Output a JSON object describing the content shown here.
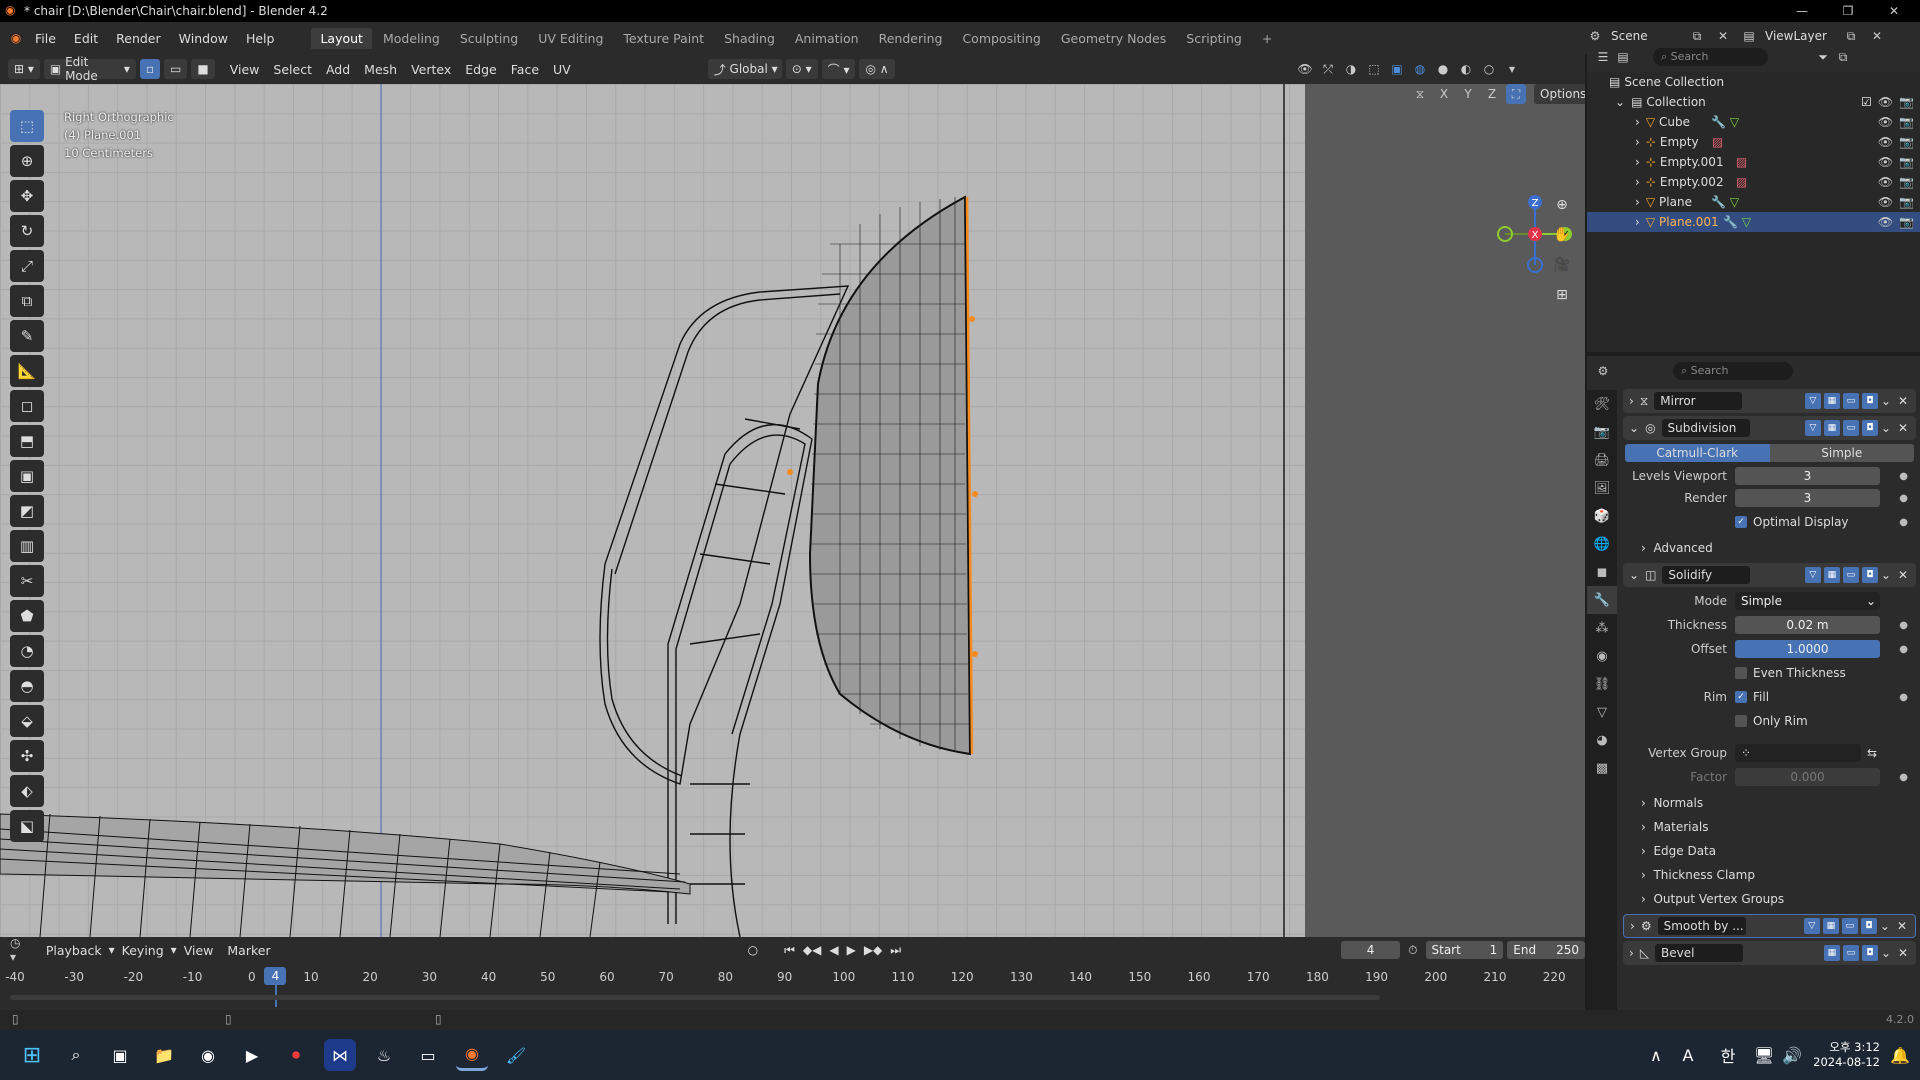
{
  "window": {
    "title": "* chair [D:\\Blender\\Chair\\chair.blend] - Blender 4.2",
    "minimize": "—",
    "maximize": "❐",
    "close": "✕"
  },
  "menu": [
    "File",
    "Edit",
    "Render",
    "Window",
    "Help"
  ],
  "workspaces": [
    "Layout",
    "Modeling",
    "Sculpting",
    "UV Editing",
    "Texture Paint",
    "Shading",
    "Animation",
    "Rendering",
    "Compositing",
    "Geometry Nodes",
    "Scripting"
  ],
  "active_workspace": "Layout",
  "scene": {
    "label": "Scene",
    "viewlayer": "ViewLayer"
  },
  "viewport_header": {
    "mode": "Edit Mode",
    "menus": [
      "View",
      "Select",
      "Add",
      "Mesh",
      "Vertex",
      "Edge",
      "Face",
      "UV"
    ],
    "transform_orientation": "Global",
    "options": "Options",
    "axes": [
      "X",
      "Y",
      "Z"
    ]
  },
  "viewport_info": {
    "view": "Right Orthographic",
    "object": "(4) Plane.001",
    "scale": "10 Centimeters"
  },
  "gizmo": {
    "z": "Z",
    "x": "X",
    "y": "Y"
  },
  "outliner": {
    "search_placeholder": "Search",
    "root": "Scene Collection",
    "collection": "Collection",
    "items": [
      "Cube",
      "Empty",
      "Empty.001",
      "Empty.002",
      "Plane",
      "Plane.001"
    ],
    "selected": "Plane.001"
  },
  "properties": {
    "search_placeholder": "Search",
    "modifiers": {
      "mirror": "Mirror",
      "subdivision": "Subdivision",
      "subdiv_types": [
        "Catmull-Clark",
        "Simple"
      ],
      "levels_viewport_label": "Levels Viewport",
      "levels_viewport": "3",
      "render_label": "Render",
      "render": "3",
      "optimal_display": "Optimal Display",
      "advanced": "Advanced",
      "solidify": "Solidify",
      "mode_label": "Mode",
      "mode": "Simple",
      "thickness_label": "Thickness",
      "thickness": "0.02 m",
      "offset_label": "Offset",
      "offset": "1.0000",
      "even_thickness": "Even Thickness",
      "rim_label": "Rim",
      "fill": "Fill",
      "only_rim": "Only Rim",
      "vertex_group_label": "Vertex Group",
      "factor_label": "Factor",
      "factor": "0.000",
      "subpanels": [
        "Normals",
        "Materials",
        "Edge Data",
        "Thickness Clamp",
        "Output Vertex Groups"
      ],
      "smooth": "Smooth by ...",
      "bevel": "Bevel"
    }
  },
  "timeline": {
    "menus": [
      "Playback",
      "Keying",
      "View",
      "Marker"
    ],
    "current_frame": "4",
    "start_label": "Start",
    "start": "1",
    "end_label": "End",
    "end": "250",
    "ruler": [
      "-40",
      "-30",
      "-20",
      "-10",
      "0",
      "10",
      "20",
      "30",
      "40",
      "50",
      "60",
      "70",
      "80",
      "90",
      "100",
      "110",
      "120",
      "130",
      "140",
      "150",
      "160",
      "170",
      "180",
      "190",
      "200",
      "210",
      "220"
    ]
  },
  "statusbar": {
    "version": "4.2.0"
  },
  "taskbar": {
    "time": "오후 3:12",
    "date": "2024-08-12",
    "ime": "A",
    "ime2": "한"
  }
}
